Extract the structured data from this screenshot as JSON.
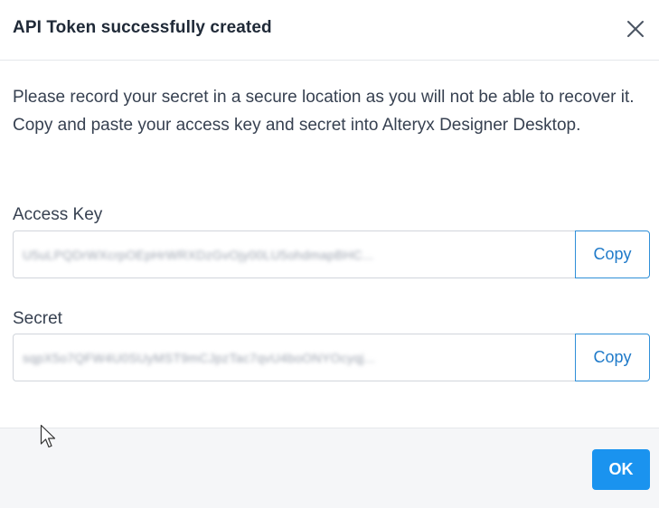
{
  "dialog": {
    "title": "API Token successfully created",
    "close_icon": "close-icon",
    "message": "Please record your secret in a secure location as you will not be able to recover it. Copy and paste your access key and secret into Alteryx Designer Desktop."
  },
  "access_key": {
    "label": "Access Key",
    "value": "U5uLPQDrWXcrpOEpHrWRXDzGvOjy00LU5ohdmapBHC...",
    "copy_label": "Copy"
  },
  "secret": {
    "label": "Secret",
    "value": "sqpX5o7QFW4U0SUyMST9mCJpzTac7qvU4boONYOcyqj...",
    "copy_label": "Copy"
  },
  "footer": {
    "ok_label": "OK"
  },
  "colors": {
    "accent": "#1a93ef",
    "copy_border": "#2f8fd8",
    "footer_bg": "#f5f6f8"
  }
}
